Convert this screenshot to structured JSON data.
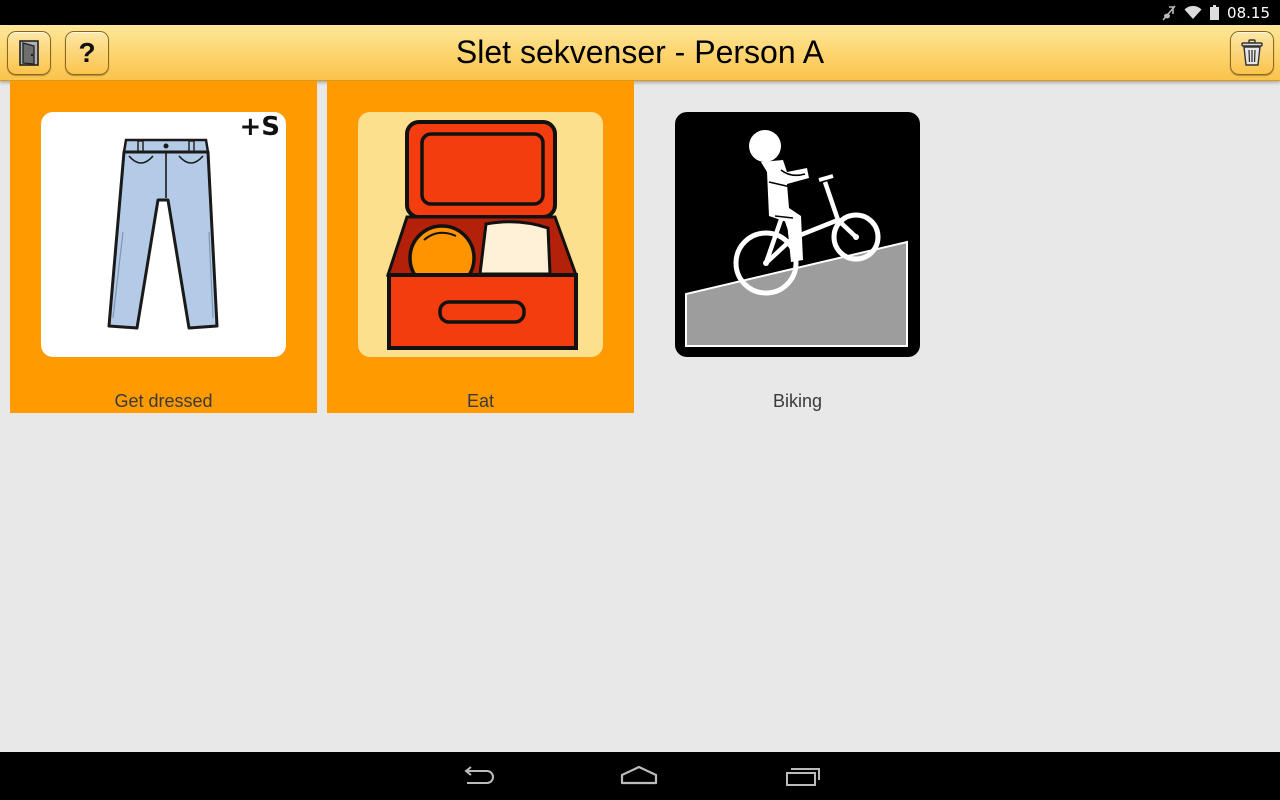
{
  "status_bar": {
    "time": "08.15",
    "icons": [
      "mute-icon",
      "wifi-icon",
      "battery-icon"
    ]
  },
  "action_bar": {
    "title": "Slet sekvenser - Person A",
    "left_buttons": [
      "exit-door-icon",
      "help-icon"
    ],
    "help_glyph": "?",
    "right_buttons": [
      "trash-icon"
    ]
  },
  "sequences": [
    {
      "label": "Get dressed",
      "icon": "jeans-pictogram",
      "selected": true,
      "badge": "+S"
    },
    {
      "label": "Eat",
      "icon": "lunchbox-pictogram",
      "selected": true
    },
    {
      "label": "Biking",
      "icon": "biking-pictogram",
      "selected": false
    }
  ],
  "colors": {
    "selected_tile": "#ff9a00",
    "action_bar": "#fdd774",
    "background": "#e8e8e8"
  },
  "nav_bar": {
    "buttons": [
      "back-icon",
      "home-icon",
      "recents-icon"
    ]
  }
}
